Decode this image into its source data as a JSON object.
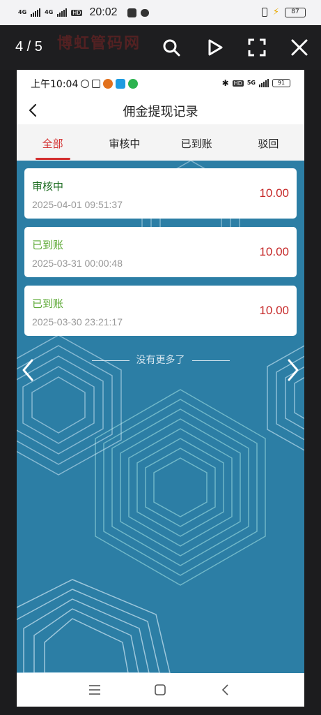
{
  "outer_status": {
    "net1": "4G",
    "net2": "4G",
    "hd": "HD",
    "time": "20:02",
    "app_icon1": "taobao-icon",
    "app_icon2": "message-icon",
    "battery": "87"
  },
  "viewer": {
    "counter": "4 / 5",
    "watermark": "博虹管码网",
    "icons": [
      "search-icon",
      "play-icon",
      "fullscreen-icon",
      "close-icon"
    ]
  },
  "inner_status": {
    "time": "上午10:04",
    "net": "5G",
    "hd": "HD",
    "battery": "91"
  },
  "header": {
    "title": "佣金提现记录"
  },
  "tabs": [
    {
      "label": "全部",
      "active": true
    },
    {
      "label": "审核中",
      "active": false
    },
    {
      "label": "已到账",
      "active": false
    },
    {
      "label": "驳回",
      "active": false
    }
  ],
  "records": [
    {
      "status": "审核中",
      "date": "2025-04-01 09:51:37",
      "amount": "10.00",
      "status_color": "#1b6b1f"
    },
    {
      "status": "已到账",
      "date": "2025-03-31 00:00:48",
      "amount": "10.00",
      "status_color": "#5aa832"
    },
    {
      "status": "已到账",
      "date": "2025-03-30 23:21:17",
      "amount": "10.00",
      "status_color": "#5aa832"
    }
  ],
  "footer_text": "没有更多了",
  "colors": {
    "accent_red": "#d32f2f",
    "background_teal": "#2c7ea5"
  }
}
